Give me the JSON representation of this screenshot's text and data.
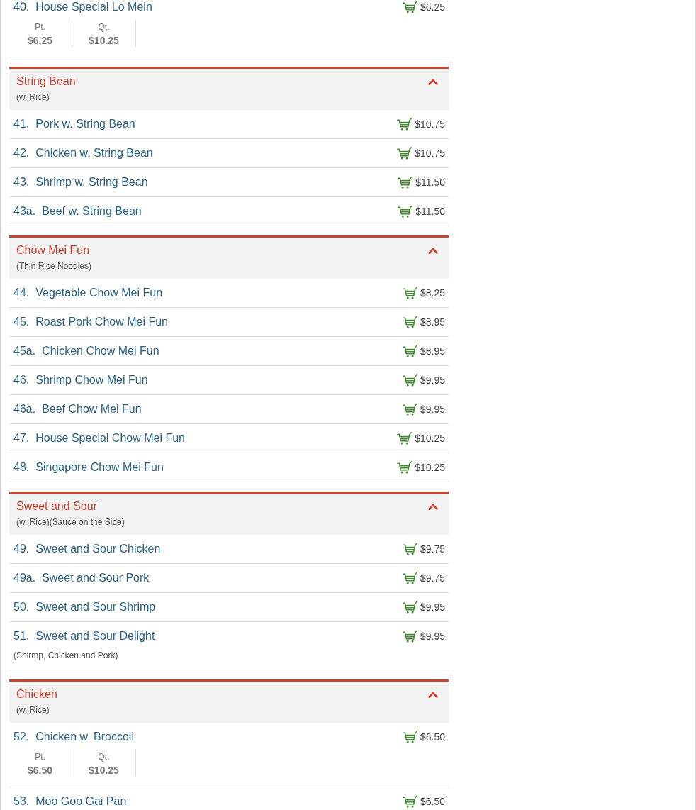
{
  "sections": [
    {
      "items": [
        {
          "number": "40.",
          "name": "House Special Lo Mein",
          "price": "$6.25",
          "sizes": [
            {
              "label": "Pt.",
              "price": "$6.25"
            },
            {
              "label": "Qt.",
              "price": "$10.25"
            }
          ]
        }
      ]
    },
    {
      "title": "String Bean",
      "subtitle": "(w. Rice)",
      "expanded": true,
      "items": [
        {
          "number": "41.",
          "name": "Pork w. String Bean",
          "price": "$10.75"
        },
        {
          "number": "42.",
          "name": "Chicken w. String Bean",
          "price": "$10.75"
        },
        {
          "number": "43.",
          "name": "Shrimp w. String Bean",
          "price": "$11.50"
        },
        {
          "number": "43a.",
          "name": "Beef w. String Bean",
          "price": "$11.50"
        }
      ]
    },
    {
      "title": "Chow Mei Fun",
      "subtitle": "(Thin Rice Noodles)",
      "expanded": true,
      "items": [
        {
          "number": "44.",
          "name": "Vegetable Chow Mei Fun",
          "price": "$8.25"
        },
        {
          "number": "45.",
          "name": "Roast Pork Chow Mei Fun",
          "price": "$8.95"
        },
        {
          "number": "45a.",
          "name": "Chicken Chow Mei Fun",
          "price": "$8.95"
        },
        {
          "number": "46.",
          "name": "Shrimp Chow Mei Fun",
          "price": "$9.95"
        },
        {
          "number": "46a.",
          "name": "Beef Chow Mei Fun",
          "price": "$9.95"
        },
        {
          "number": "47.",
          "name": "House Special Chow Mei Fun",
          "price": "$10.25"
        },
        {
          "number": "48.",
          "name": "Singapore Chow Mei Fun",
          "price": "$10.25"
        }
      ]
    },
    {
      "title": "Sweet and Sour",
      "subtitle": "(w. Rice)(Sauce on the Side)",
      "expanded": true,
      "items": [
        {
          "number": "49.",
          "name": "Sweet and Sour Chicken",
          "price": "$9.75"
        },
        {
          "number": "49a.",
          "name": "Sweet and Sour Pork",
          "price": "$9.75"
        },
        {
          "number": "50.",
          "name": "Sweet and Sour Shrimp",
          "price": "$9.95"
        },
        {
          "number": "51.",
          "name": "Sweet and Sour Delight",
          "price": "$9.95",
          "description": "(Shirmp, Chicken and Pork)"
        }
      ]
    },
    {
      "title": "Chicken",
      "subtitle": "(w. Rice)",
      "expanded": true,
      "items": [
        {
          "number": "52.",
          "name": "Chicken w. Broccoli",
          "price": "$6.50",
          "sizes": [
            {
              "label": "Pt.",
              "price": "$6.50"
            },
            {
              "label": "Qt.",
              "price": "$10.25"
            }
          ]
        },
        {
          "number": "53.",
          "name": "Moo Goo Gai Pan",
          "price": "$6.50"
        }
      ]
    }
  ]
}
